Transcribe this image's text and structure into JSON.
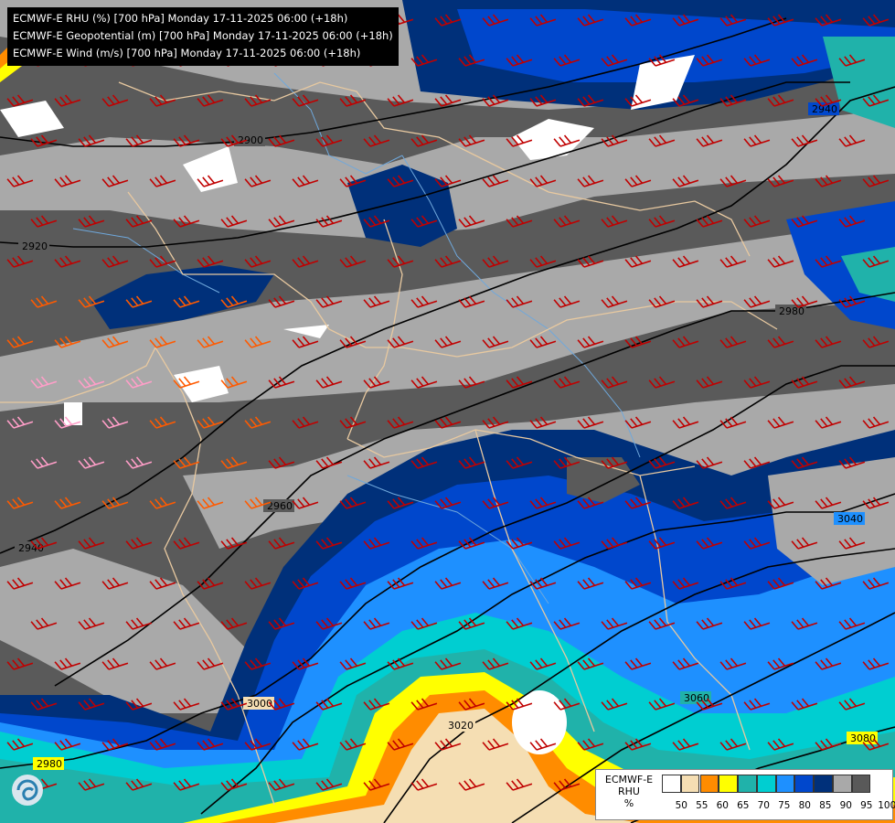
{
  "title_lines": [
    "ECMWF-E RHU (%) [700 hPa] Monday 17-11-2025 06:00 (+18h)",
    "ECMWF-E Geopotential (m) [700 hPa] Monday 17-11-2025 06:00 (+18h)",
    "ECMWF-E Wind (m/s) [700 hPa] Monday 17-11-2025 06:00 (+18h)"
  ],
  "legend": {
    "title_lines": [
      "ECMWF-E",
      "RHU",
      "%"
    ],
    "ticks": [
      "50",
      "55",
      "60",
      "65",
      "70",
      "75",
      "80",
      "85",
      "90",
      "95",
      "100"
    ],
    "colors": [
      "#ffffff",
      "#f5deb3",
      "#ff8c00",
      "#ffff00",
      "#20b2aa",
      "#00ced1",
      "#1e90ff",
      "#0047cc",
      "#00307a",
      "#a9a9a9",
      "#595959"
    ]
  },
  "contours": [
    {
      "label": "2900",
      "value": 2900
    },
    {
      "label": "2920",
      "value": 2920
    },
    {
      "label": "2940",
      "value": 2940
    },
    {
      "label": "2960",
      "value": 2960
    },
    {
      "label": "2980",
      "value": 2980
    },
    {
      "label": "3000",
      "value": 3000
    },
    {
      "label": "3020",
      "value": 3020
    },
    {
      "label": "3040",
      "value": 3040
    },
    {
      "label": "3060",
      "value": 3060
    },
    {
      "label": "3080",
      "value": 3080
    }
  ],
  "icons": {
    "logo": "ecmwf-swirl-logo",
    "wind_barb": "wind-barb-icon"
  },
  "colors": {
    "wind_strong": "#c00000",
    "wind_medium": "#ff5a00",
    "wind_weak": "#ff9ec8",
    "border": "#e8c9a0",
    "river": "#6fa8dc",
    "contour": "#000000"
  }
}
